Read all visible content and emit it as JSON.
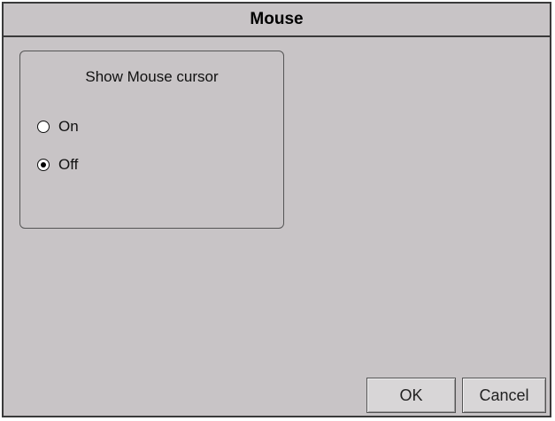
{
  "window": {
    "title": "Mouse"
  },
  "mouse_settings": {
    "group_label": "Show Mouse cursor",
    "options": [
      {
        "label": "On",
        "selected": false
      },
      {
        "label": "Off",
        "selected": true
      }
    ]
  },
  "buttons": {
    "ok_label": "OK",
    "cancel_label": "Cancel"
  },
  "colors": {
    "background": "#c8c4c6",
    "border": "#3a3a3a"
  }
}
